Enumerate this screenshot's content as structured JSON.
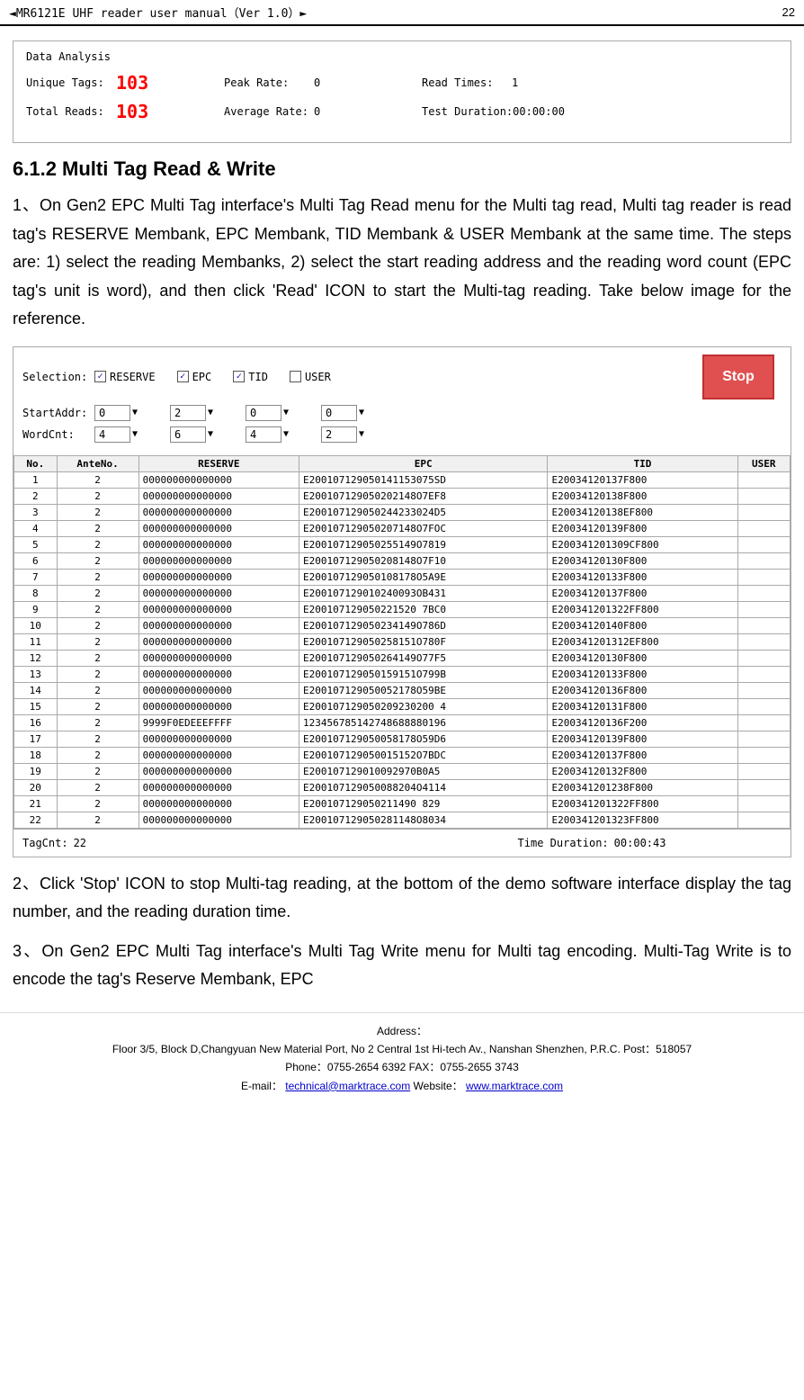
{
  "header": {
    "title": "◄MR6121E UHF reader user manual（Ver 1.0）►",
    "page": "22"
  },
  "dataAnalysis": {
    "title": "Data Analysis",
    "row1": {
      "uniqueTagsLabel": "Unique Tags:",
      "uniqueTagsValue": "103",
      "peakRateLabel": "Peak Rate:",
      "peakRateValue": "0",
      "readTimesLabel": "Read Times:",
      "readTimesValue": "1"
    },
    "row2": {
      "totalReadsLabel": "Total Reads:",
      "totalReadsValue": "103",
      "avgRateLabel": "Average Rate:",
      "avgRateValue": "0",
      "testDurationLabel": "Test Duration:",
      "testDurationValue": "00:00:00"
    }
  },
  "sectionTitle": "6.1.2 Multi Tag Read & Write",
  "bodyText1": "1、On Gen2 EPC Multi Tag interface's Multi Tag Read menu for the Multi tag read, Multi tag reader is read tag's RESERVE Membank, EPC Membank, TID Membank & USER Membank at the same time. The steps are: 1) select the reading Membanks, 2) select the start reading address and the reading word count (EPC tag's unit is word), and then click 'Read' ICON to start the Multi-tag reading. Take below image for the reference.",
  "interface": {
    "selectionLabel": "Selection:",
    "checkboxes": [
      {
        "id": "cb-reserve",
        "label": "RESERVE",
        "checked": true
      },
      {
        "id": "cb-epc",
        "label": "EPC",
        "checked": true
      },
      {
        "id": "cb-tid",
        "label": "TID",
        "checked": true
      },
      {
        "id": "cb-user",
        "label": "USER",
        "checked": false
      }
    ],
    "startAddrLabel": "StartAddr:",
    "startAddrValues": [
      "0",
      "2",
      "0",
      "0"
    ],
    "wordCntLabel": "WordCnt:",
    "wordCntValues": [
      "4",
      "6",
      "4",
      "2"
    ],
    "stopButton": "Stop",
    "tableHeaders": [
      "No.",
      "AnteNo.",
      "RESERVE",
      "EPC",
      "TID",
      "USER"
    ],
    "tableRows": [
      [
        "1",
        "2",
        "000000000000000",
        "E200107129050141153075SD",
        "E20034120137F800",
        ""
      ],
      [
        "2",
        "2",
        "000000000000000",
        "E200107129050202148O7EF8",
        "E20034120138F800",
        ""
      ],
      [
        "3",
        "2",
        "000000000000000",
        "E200107129050244233024D5",
        "E20034120138EF800",
        ""
      ],
      [
        "4",
        "2",
        "000000000000000",
        "E200107129050207148O7FOC",
        "E20034120139F800",
        ""
      ],
      [
        "5",
        "2",
        "000000000000000",
        "E200107129050255149O7819",
        "E200341201309CF800",
        ""
      ],
      [
        "6",
        "2",
        "000000000000000",
        "E200107129050208148O7F10",
        "E20034120130F800",
        ""
      ],
      [
        "7",
        "2",
        "000000000000000",
        "E200107129050108178O5A9E",
        "E20034120133F800",
        ""
      ],
      [
        "8",
        "2",
        "000000000000000",
        "E200107129010240093OB431",
        "E20034120137F800",
        ""
      ],
      [
        "9",
        "2",
        "000000000000000",
        "E200107129050221520 7BC0",
        "E200341201322FF800",
        ""
      ],
      [
        "10",
        "2",
        "000000000000000",
        "E200107129050234149O786D",
        "E20034120140F800",
        ""
      ],
      [
        "11",
        "2",
        "000000000000000",
        "E200107129050258151O780F",
        "E200341201312EF800",
        ""
      ],
      [
        "12",
        "2",
        "000000000000000",
        "E200107129050264149O77F5",
        "E20034120130F800",
        ""
      ],
      [
        "13",
        "2",
        "000000000000000",
        "E200107129050159151O799B",
        "E20034120133F800",
        ""
      ],
      [
        "14",
        "2",
        "000000000000000",
        "E200107129050052178O59BE",
        "E20034120136F800",
        ""
      ],
      [
        "15",
        "2",
        "000000000000000",
        "E200107129050209230200 4",
        "E20034120131F800",
        ""
      ],
      [
        "16",
        "2",
        "9999F0EDEEEFFFF",
        "123456785142748688880196",
        "E20034120136F200",
        ""
      ],
      [
        "17",
        "2",
        "000000000000000",
        "E200107129050058178O59D6",
        "E20034120139F800",
        ""
      ],
      [
        "18",
        "2",
        "000000000000000",
        "E200107129050015152O7BDC",
        "E20034120137F800",
        ""
      ],
      [
        "19",
        "2",
        "000000000000000",
        "E200107129010092970B0A5",
        "E20034120132F800",
        ""
      ],
      [
        "20",
        "2",
        "000000000000000",
        "E200107129050088204O4114",
        "E200341201238F800",
        ""
      ],
      [
        "21",
        "2",
        "000000000000000",
        "E200107129050211490 829",
        "E200341201322FF800",
        ""
      ],
      [
        "22",
        "2",
        "000000000000000",
        "E200107129050281148O8034",
        "E200341201323FF800",
        ""
      ]
    ],
    "footer": {
      "tagCntLabel": "TagCnt:",
      "tagCntValue": "22",
      "timeDurationLabel": "Time Duration:",
      "timeDurationValue": "00:00:43"
    }
  },
  "bodyText2": "2、Click 'Stop' ICON to stop Multi-tag reading, at the bottom of the demo software interface display the tag number, and the reading duration time.",
  "bodyText3": "3、On Gen2 EPC Multi Tag interface's Multi Tag Write menu for Multi tag encoding. Multi-Tag Write is to encode the tag's Reserve Membank, EPC",
  "footer": {
    "line1": "Address：",
    "line2": "Floor 3/5, Block D,Changyuan New  Material Port, No 2 Central 1st Hi-tech Av., Nanshan Shenzhen, P.R.C.    Post：518057",
    "line3": "Phone：0755-2654 6392     FAX：0755-2655 3743",
    "line4pre": "E-mail：",
    "emailLink": "technical@marktrace.com",
    "line4mid": "        Website：",
    "websiteLink": "www.marktrace.com"
  }
}
